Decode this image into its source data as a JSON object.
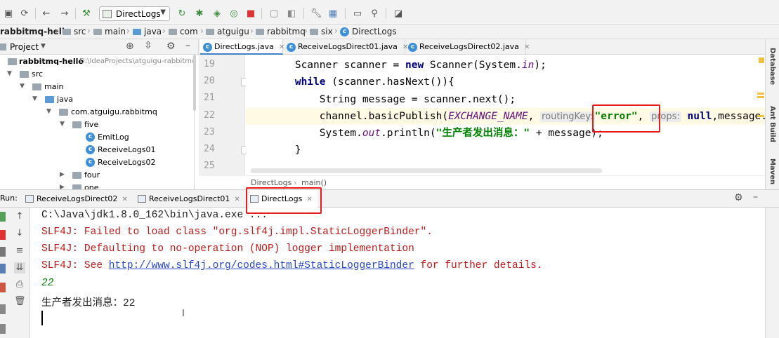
{
  "toolbar": {
    "run_config": "DirectLogs"
  },
  "breadcrumb": {
    "project": "rabbitmq-hello",
    "items": [
      "src",
      "main",
      "java",
      "com",
      "atguigu",
      "rabbitmq",
      "six",
      "DirectLogs"
    ]
  },
  "project_panel": {
    "title": "Project",
    "root_label": "rabbitmq-hello",
    "root_path": "D:\\IdeaProjects\\atguigu-rabbitmq",
    "tree": {
      "src": "src",
      "main": "main",
      "java": "java",
      "package": "com.atguigu.rabbitmq",
      "five": "five",
      "emitlog": "EmitLog",
      "receive01": "ReceiveLogs01",
      "receive02": "ReceiveLogs02",
      "four": "four",
      "one": "one"
    }
  },
  "editor": {
    "tabs": [
      "DirectLogs.java",
      "ReceiveLogsDirect01.java",
      "ReceiveLogsDirect02.java"
    ],
    "line_numbers": [
      "19",
      "20",
      "21",
      "22",
      "23",
      "24",
      "25"
    ],
    "lines": {
      "l19_a": "        Scanner scanner = ",
      "l19_new": "new",
      "l19_b": " Scanner(System.",
      "l19_in": "in",
      "l19_c": ");",
      "l20_while": "while",
      "l20_b": " (scanner.hasNext()){",
      "l21": "            String message = scanner.next();",
      "l22_a": "            channel.basicPublish(",
      "l22_const": "EXCHANGE_NAME",
      "l22_b": ", ",
      "l22_hint_routing": "routingKey:",
      "l22_str": "\"error\"",
      "l22_c": ", ",
      "l22_hint_props": "props:",
      "l22_null": "null",
      "l22_d": ",message.",
      "l23_a": "            System.",
      "l23_out": "out",
      "l23_b": ".println(",
      "l23_str": "\"生产者发出消息：\"",
      "l23_c": " + message);",
      "l24": "        }",
      "l25": ""
    },
    "crumb_class": "DirectLogs",
    "crumb_method": "main()"
  },
  "right_tools": [
    "Database",
    "Ant Build",
    "Maven"
  ],
  "run": {
    "label": "Run:",
    "tabs": [
      "ReceiveLogsDirect02",
      "ReceiveLogsDirect01",
      "DirectLogs"
    ],
    "console": {
      "l1": "C:\\Java\\jdk1.8.0_162\\bin\\java.exe ...",
      "l2": "SLF4J: Failed to load class \"org.slf4j.impl.StaticLoggerBinder\".",
      "l3": "SLF4J: Defaulting to no-operation (NOP) logger implementation",
      "l4_a": "SLF4J: See ",
      "l4_link": "http://www.slf4j.org/codes.html#StaticLoggerBinder",
      "l4_b": " for further details.",
      "l5": "22",
      "l6": "生产者发出消息：22"
    }
  },
  "colors": {
    "highlight_box": "#e51c1c",
    "keyword": "#000080",
    "string": "#008000",
    "error_text": "#c01818",
    "link": "#2846c8"
  }
}
